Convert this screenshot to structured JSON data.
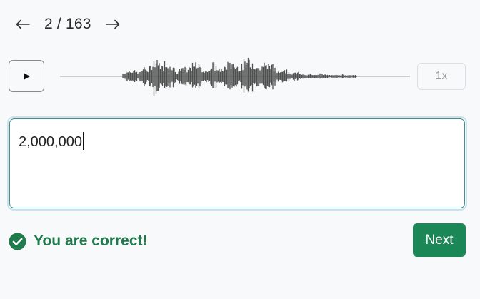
{
  "nav": {
    "prev_icon": "arrow-left-icon",
    "counter": "2 / 163",
    "next_icon": "arrow-right-icon"
  },
  "player": {
    "play_icon": "play-icon",
    "speed_label": "1x"
  },
  "answer": {
    "value": "2,000,000"
  },
  "feedback": {
    "icon": "check-circle-icon",
    "message": "You are correct!"
  },
  "actions": {
    "next_label": "Next"
  },
  "colors": {
    "success": "#1f7a4c",
    "primary_button": "#1b8756",
    "waveform": "#4f4f4f",
    "focus_ring": "#c9e2ef"
  }
}
